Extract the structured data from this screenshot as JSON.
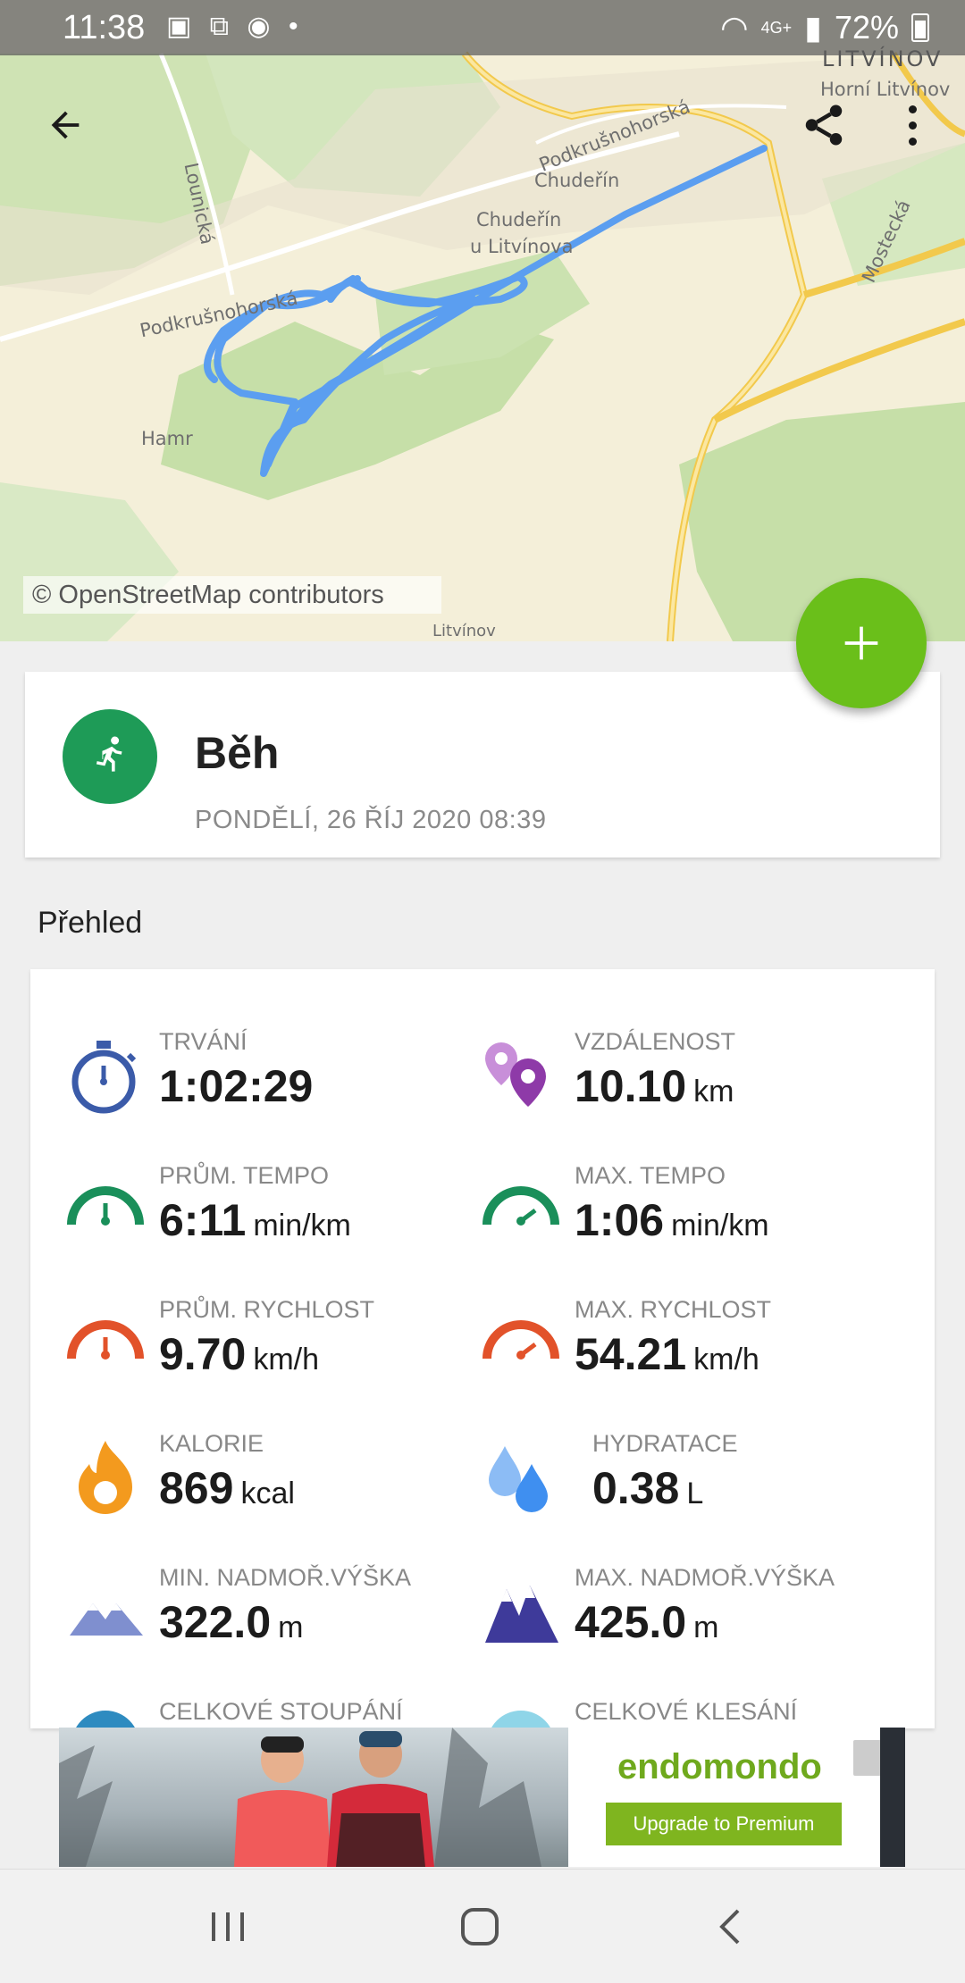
{
  "status_bar": {
    "time": "11:38",
    "network": "4G+",
    "battery": "72%"
  },
  "map": {
    "attribution": "© OpenStreetMap contributors",
    "labels": {
      "litvinov": "LITVÍNOV",
      "horni_litvinov": "Horní Litvínov",
      "podkrusnohorska_1": "Podkrušnohorská",
      "podkrusnohorska_2": "Podkrušnohorská",
      "chuderin_1": "Chudeřín",
      "chuderin_2": "Chudeřín",
      "u_litvinova": "u Litvínova",
      "lounicka": "Lounická",
      "mostecka": "Mostecká",
      "hamr": "Hamr",
      "litvinov_bottom": "Litvínov"
    },
    "route_color": "#5b9ef0"
  },
  "workout": {
    "sport": "Běh",
    "date": "PONDĚLÍ, 26 ŘÍJ 2020 08:39",
    "sport_color": "#1e9b57"
  },
  "overview": {
    "title": "Přehled",
    "stats": [
      {
        "label": "TRVÁNÍ",
        "value": "1:02:29",
        "unit": ""
      },
      {
        "label": "VZDÁLENOST",
        "value": "10.10",
        "unit": "km"
      },
      {
        "label": "PRŮM. TEMPO",
        "value": "6:11",
        "unit": "min/km"
      },
      {
        "label": "MAX. TEMPO",
        "value": "1:06",
        "unit": "min/km"
      },
      {
        "label": "PRŮM. RYCHLOST",
        "value": "9.70",
        "unit": "km/h"
      },
      {
        "label": "MAX. RYCHLOST",
        "value": "54.21",
        "unit": "km/h"
      },
      {
        "label": "KALORIE",
        "value": "869",
        "unit": "kcal"
      },
      {
        "label": "HYDRATACE",
        "value": "0.38",
        "unit": "L"
      },
      {
        "label": "MIN. NADMOŘ.VÝŠKA",
        "value": "322.0",
        "unit": "m"
      },
      {
        "label": "MAX. NADMOŘ.VÝŠKA",
        "value": "425.0",
        "unit": "m"
      },
      {
        "label": "CELKOVÉ STOUPÁNÍ",
        "value": "",
        "unit": ""
      },
      {
        "label": "CELKOVÉ KLESÁNÍ",
        "value": "",
        "unit": ""
      }
    ]
  },
  "ad": {
    "brand": "endomondo",
    "button": "Upgrade to Premium"
  },
  "colors": {
    "accent_green": "#6abf1a",
    "duration_blue": "#3b5ba9",
    "distance_purple": "#8e3aa8",
    "pace_green": "#1a8f5a",
    "speed_red": "#e2522a",
    "calories_orange": "#f39a1e",
    "hydration_blue": "#3f8ff0",
    "altitude_min": "#7f8fcf",
    "altitude_max": "#3e3a9a"
  }
}
